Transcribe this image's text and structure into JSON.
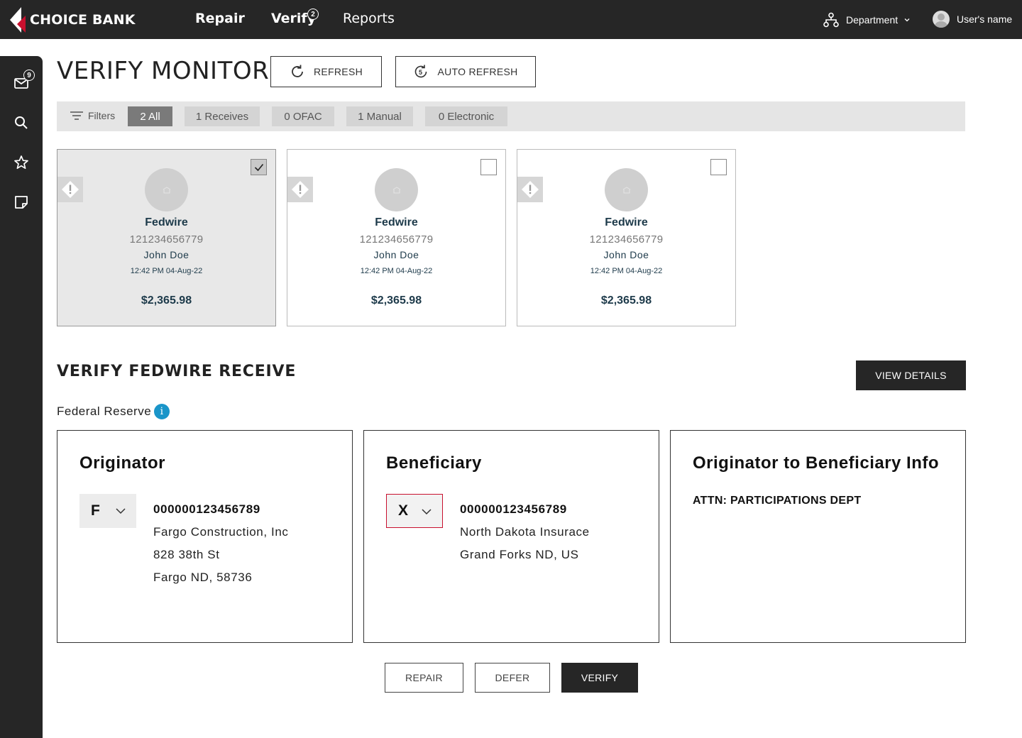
{
  "brand": {
    "name": "CHOICE BANK",
    "accent": "#c8102e"
  },
  "nav": {
    "repair": "Repair",
    "verify": "Verify",
    "verify_badge": "2",
    "reports": "Reports"
  },
  "header_right": {
    "department": "Department",
    "user_name": "User's name"
  },
  "sidebar": {
    "inbox_badge": "9",
    "icons": [
      "mail-icon",
      "search-icon",
      "star-icon",
      "note-icon"
    ]
  },
  "page": {
    "title": "VERIFY MONITOR",
    "refresh_label": "REFRESH",
    "auto_refresh_label": "AUTO REFRESH",
    "auto_refresh_interval": "5"
  },
  "filters": {
    "label": "Filters",
    "chips": [
      {
        "label": "2 All",
        "active": true
      },
      {
        "label": "1 Receives",
        "active": false
      },
      {
        "label": "0 OFAC",
        "active": false
      },
      {
        "label": "1 Manual",
        "active": false
      },
      {
        "label": "0 Electronic",
        "active": false
      }
    ]
  },
  "cards": [
    {
      "type": "Fedwire",
      "account": "121234656779",
      "name": "John Doe",
      "time": "12:42 PM 04-Aug-22",
      "amount": "$2,365.98",
      "selected": true
    },
    {
      "type": "Fedwire",
      "account": "121234656779",
      "name": "John Doe",
      "time": "12:42 PM 04-Aug-22",
      "amount": "$2,365.98",
      "selected": false
    },
    {
      "type": "Fedwire",
      "account": "121234656779",
      "name": "John Doe",
      "time": "12:42 PM 04-Aug-22",
      "amount": "$2,365.98",
      "selected": false
    }
  ],
  "detail": {
    "title": "VERIFY FEDWIRE RECEIVE",
    "view_details": "VIEW DETAILS",
    "source": "Federal Reserve",
    "originator": {
      "heading": "Originator",
      "id_type": "F",
      "account": "000000123456789",
      "line1": "Fargo Construction, Inc",
      "line2": "828 38th St",
      "line3": "Fargo ND, 58736"
    },
    "beneficiary": {
      "heading": "Beneficiary",
      "id_type": "X",
      "account": "000000123456789",
      "line1": "North Dakota Insurace",
      "line2": "Grand Forks ND, US"
    },
    "obi": {
      "heading": "Originator to Beneficiary Info",
      "text": "ATTN: PARTICIPATIONS DEPT"
    }
  },
  "actions": {
    "repair": "REPAIR",
    "defer": "DEFER",
    "verify": "VERIFY"
  }
}
